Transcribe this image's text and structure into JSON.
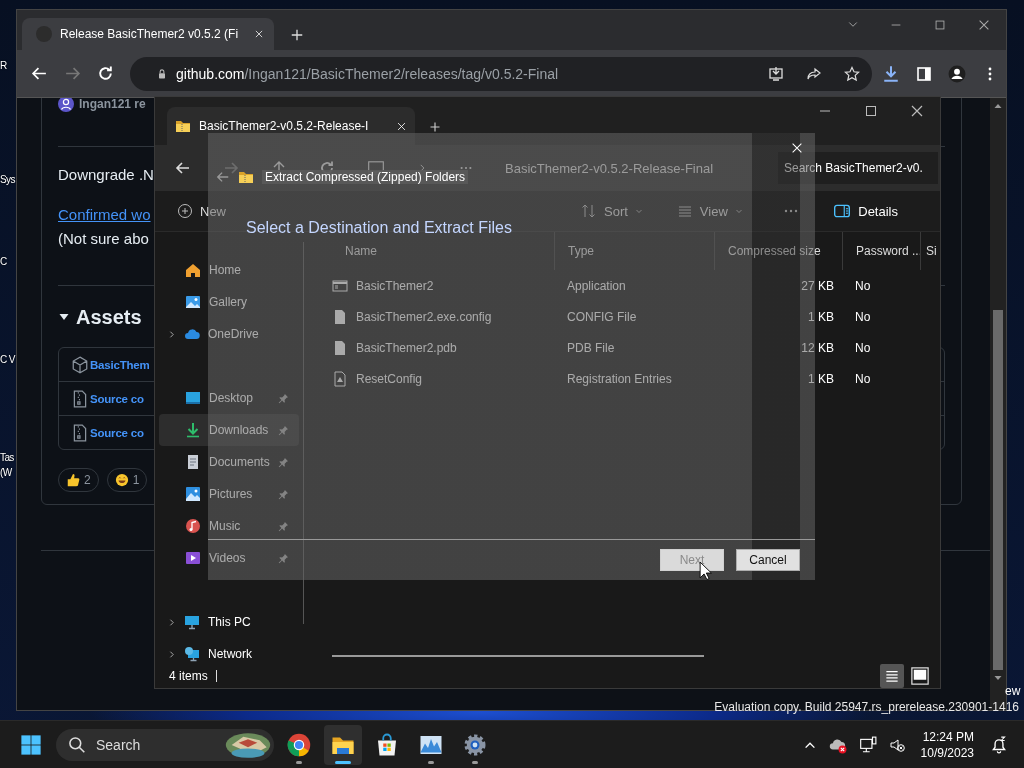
{
  "desktop": {
    "icon_labels": [
      "R",
      "Sys",
      "C",
      "C V",
      "Tas (W"
    ],
    "right_edge_label": "ew",
    "build_notice": "Evaluation copy. Build 25947.rs_prerelease.230901-1416"
  },
  "browser": {
    "tabs": [
      {
        "title": "Release BasicThemer2 v0.5.2 (Fi",
        "selected": true
      }
    ],
    "back_enabled": true,
    "forward_enabled": false,
    "url_host": "github.com",
    "url_path": "/Ingan121/BasicThemer2/releases/tag/v0.5.2-Final",
    "page": {
      "author": "Ingan121 re",
      "paragraph_1": "Downgrade .N",
      "link": "Confirmed wo",
      "paragraph_2": "(Not sure abo",
      "assets_title": "Assets",
      "assets_expanded": true,
      "assets": [
        {
          "kind": "package",
          "label": "BasicThem"
        },
        {
          "kind": "zip",
          "label": "Source co"
        },
        {
          "kind": "zip",
          "label": "Source co"
        }
      ],
      "reactions": [
        {
          "kind": "thumbs-up",
          "count": "2"
        },
        {
          "kind": "smile",
          "count": "1"
        }
      ]
    }
  },
  "explorer": {
    "tab_title": "BasicThemer2-v0.5.2-Release-I",
    "breadcrumb": "BasicThemer2-v0.5.2-Release-Final",
    "search_placeholder": "Search BasicThemer2-v0.",
    "commands": [
      {
        "kind": "new",
        "label": "New"
      },
      {
        "kind": "sort",
        "label": "Sort"
      },
      {
        "kind": "view",
        "label": "View"
      }
    ],
    "details_label": "Details",
    "sidebar_sections": [
      {
        "items": [
          {
            "kind": "home",
            "label": "Home",
            "has_children": false,
            "pinned": false,
            "selected": false
          },
          {
            "kind": "gallery",
            "label": "Gallery",
            "has_children": false,
            "pinned": false,
            "selected": false
          },
          {
            "kind": "cloud",
            "label": "OneDrive",
            "has_children": true,
            "pinned": false,
            "selected": false
          }
        ]
      },
      {
        "items": [
          {
            "kind": "desktop",
            "label": "Desktop",
            "has_children": false,
            "pinned": true,
            "selected": false
          },
          {
            "kind": "download",
            "label": "Downloads",
            "has_children": false,
            "pinned": true,
            "selected": true
          },
          {
            "kind": "document",
            "label": "Documents",
            "has_children": false,
            "pinned": true,
            "selected": false
          },
          {
            "kind": "picture",
            "label": "Pictures",
            "has_children": false,
            "pinned": true,
            "selected": false
          },
          {
            "kind": "music",
            "label": "Music",
            "has_children": false,
            "pinned": true,
            "selected": false
          },
          {
            "kind": "video",
            "label": "Videos",
            "has_children": false,
            "pinned": true,
            "selected": false
          }
        ]
      },
      {
        "items": [
          {
            "kind": "pc",
            "label": "This PC",
            "has_children": true,
            "pinned": false,
            "selected": false
          },
          {
            "kind": "network",
            "label": "Network",
            "has_children": true,
            "pinned": false,
            "selected": false
          }
        ]
      }
    ],
    "columns": [
      "Name",
      "Type",
      "Compressed size",
      "Password ...",
      "Si"
    ],
    "rows": [
      {
        "kind": "app",
        "name": "BasicThemer2",
        "type": "Application",
        "size": "27 KB",
        "password": "No"
      },
      {
        "kind": "file",
        "name": "BasicThemer2.exe.config",
        "type": "CONFIG File",
        "size": "1 KB",
        "password": "No"
      },
      {
        "kind": "file",
        "name": "BasicThemer2.pdb",
        "type": "PDB File",
        "size": "12 KB",
        "password": "No"
      },
      {
        "kind": "reg",
        "name": "ResetConfig",
        "type": "Registration Entries",
        "size": "1 KB",
        "password": "No"
      }
    ],
    "status": "4 items",
    "views": [
      {
        "kind": "details",
        "selected": true
      },
      {
        "kind": "tiles",
        "selected": false
      }
    ]
  },
  "dialog": {
    "title": "Extract Compressed (Zipped) Folders",
    "heading": "Select a Destination and Extract Files",
    "buttons": [
      {
        "label": "Next",
        "disabled": true
      },
      {
        "label": "Cancel",
        "disabled": false
      }
    ]
  },
  "taskbar": {
    "search_placeholder": "Search",
    "apps": [
      {
        "kind": "chrome",
        "active": false,
        "running": true
      },
      {
        "kind": "explorer",
        "active": true,
        "running": true
      },
      {
        "kind": "store",
        "active": false,
        "running": false
      },
      {
        "kind": "monitor",
        "active": false,
        "running": true
      },
      {
        "kind": "settings",
        "active": false,
        "running": true
      }
    ],
    "time": "12:24 PM",
    "date": "10/9/2023"
  }
}
